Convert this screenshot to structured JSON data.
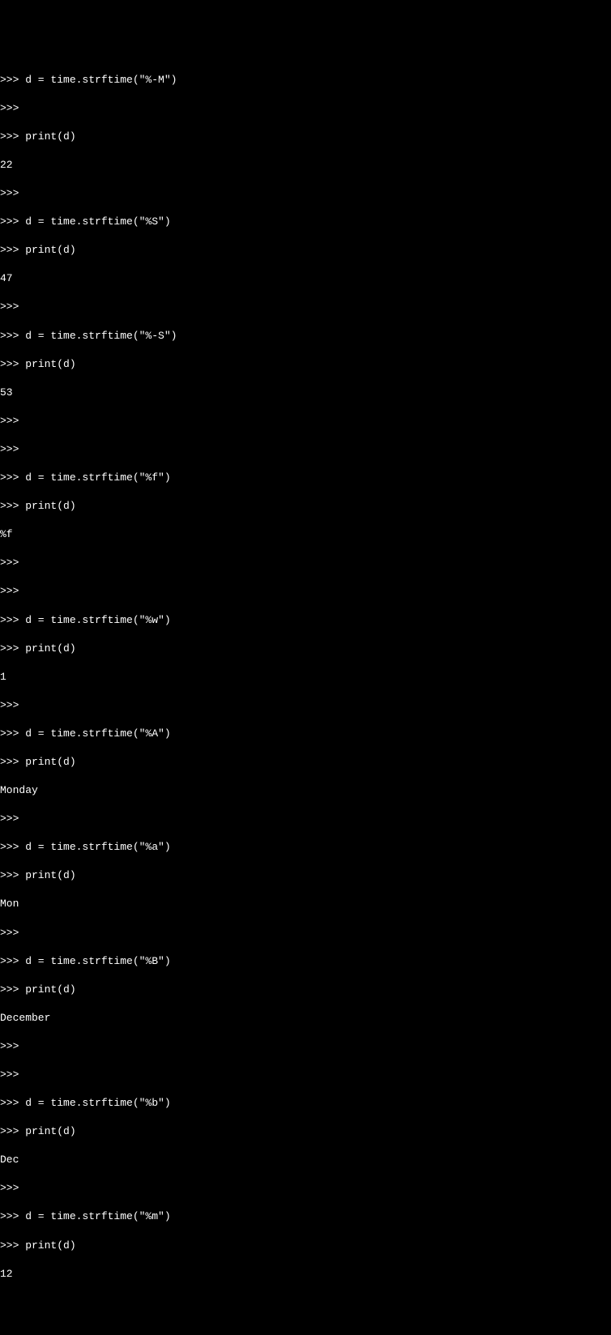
{
  "prompt": ">>>",
  "lines": [
    ">>> d = time.strftime(\"%-M\")",
    ">>>",
    ">>> print(d)",
    "22",
    ">>>",
    ">>> d = time.strftime(\"%S\")",
    ">>> print(d)",
    "47",
    ">>>",
    ">>> d = time.strftime(\"%-S\")",
    ">>> print(d)",
    "53",
    ">>>",
    ">>>",
    ">>> d = time.strftime(\"%f\")",
    ">>> print(d)",
    "%f",
    ">>>",
    ">>>",
    ">>> d = time.strftime(\"%w\")",
    ">>> print(d)",
    "1",
    ">>>",
    ">>> d = time.strftime(\"%A\")",
    ">>> print(d)",
    "Monday",
    ">>>",
    ">>> d = time.strftime(\"%a\")",
    ">>> print(d)",
    "Mon",
    ">>>",
    ">>> d = time.strftime(\"%B\")",
    ">>> print(d)",
    "December",
    ">>>",
    ">>>",
    ">>> d = time.strftime(\"%b\")",
    ">>> print(d)",
    "Dec",
    ">>>",
    ">>> d = time.strftime(\"%m\")",
    ">>> print(d)",
    "12"
  ]
}
